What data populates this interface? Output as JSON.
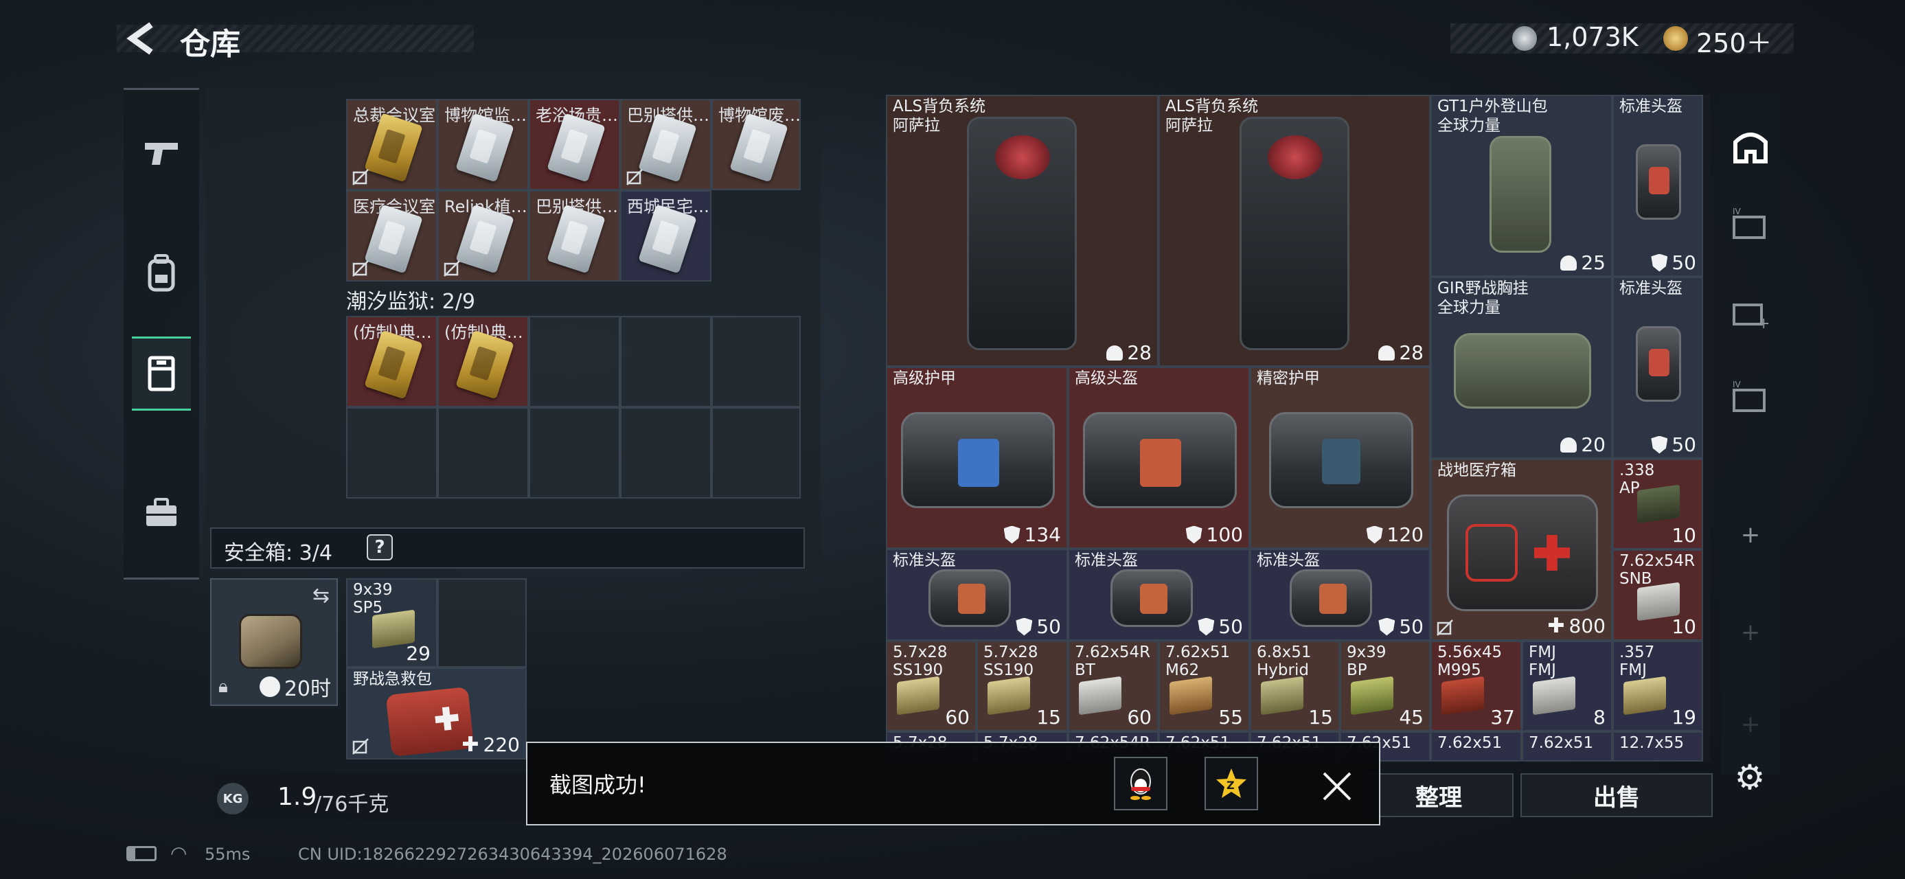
{
  "header": {
    "title": "仓库",
    "currency_1": "1,073K",
    "currency_2": "250＋"
  },
  "left_rail": {
    "items": [
      "gun-icon",
      "backpack-icon",
      "locker-icon",
      "toolbox-icon"
    ],
    "active_index": 2
  },
  "keycards": {
    "row1": [
      "总裁会议室",
      "博物馆监…",
      "老浴场贵…",
      "巴别搭供…",
      "博物馆废…"
    ],
    "row2": [
      "医疗会议室",
      "Relink植…",
      "巴别搭供…",
      "西城民宅…"
    ],
    "section_label": "潮汐监狱: 2/9",
    "prison": [
      "(仿制)典…",
      "(仿制)典…"
    ]
  },
  "safe_box": {
    "label": "安全箱: 3/4",
    "help": "?",
    "timer": "20时",
    "ammo_label": "9x39\nSP5",
    "ammo_count": "29",
    "medkit_label": "野战急救包",
    "medkit_value": "220"
  },
  "weight": {
    "current": "1.9",
    "max": "/76千克"
  },
  "grid": {
    "als1_name": "ALS背负系统",
    "als1_brand": "阿萨拉",
    "als1_value": "28",
    "als2_name": "ALS背负系统",
    "als2_brand": "阿萨拉",
    "als2_value": "28",
    "gt1_name": "GT1户外登山包",
    "gt1_brand": "全球力量",
    "gt1_value": "25",
    "helm1_name": "标准头盔",
    "helm1_value": "50",
    "gir_name": "GIR野战胸挂",
    "gir_brand": "全球力量",
    "gir_value": "20",
    "helm2_name": "标准头盔",
    "helm2_value": "50",
    "adv_armor_name": "高级护甲",
    "adv_armor_value": "134",
    "adv_helm_name": "高级头盔",
    "adv_helm_value": "100",
    "prec_armor_name": "精密护甲",
    "prec_armor_value": "120",
    "medbox_name": "战地医疗箱",
    "medbox_value": "800",
    "ammo338_name": ".338\nAP",
    "ammo338_value": "10",
    "ammo762_name": "7.62x54R\nSNB",
    "ammo762_value": "10",
    "std1_name": "标准头盔",
    "std1_value": "50",
    "std2_name": "标准头盔",
    "std2_value": "50",
    "std3_name": "标准头盔",
    "std3_value": "50",
    "ammo_row": [
      {
        "name": "5.7x28\nSS190",
        "value": "60"
      },
      {
        "name": "5.7x28\nSS190",
        "value": "15"
      },
      {
        "name": "7.62x54R\nBT",
        "value": "60"
      },
      {
        "name": "7.62x51\nM62",
        "value": "55"
      },
      {
        "name": "6.8x51\nHybrid",
        "value": "15"
      },
      {
        "name": "9x39\nBP",
        "value": "45"
      },
      {
        "name": "5.56x45\nM995",
        "value": "37"
      },
      {
        "name": "FMJ\nFMJ",
        "value": "8"
      },
      {
        "name": ".357\nFMJ",
        "value": "19"
      }
    ],
    "bottom_row": [
      "5.7x28",
      "5.7x28",
      "7.62x54R",
      "7.62x51",
      "7.62x51",
      "7.62x51",
      "7.62x51",
      "7.62x51",
      "12.7x55"
    ]
  },
  "buttons": {
    "organize": "整理",
    "sell": "出售"
  },
  "toast": {
    "text": "截图成功!"
  },
  "status": {
    "ping": "55ms",
    "uid": "CN UID:1826622927263430643394_202606071628"
  },
  "colors": {
    "accent_green": "#44d19a",
    "cell_red": "#55282a",
    "cell_brown": "#4a3530",
    "cell_navy": "#2c2f45"
  }
}
